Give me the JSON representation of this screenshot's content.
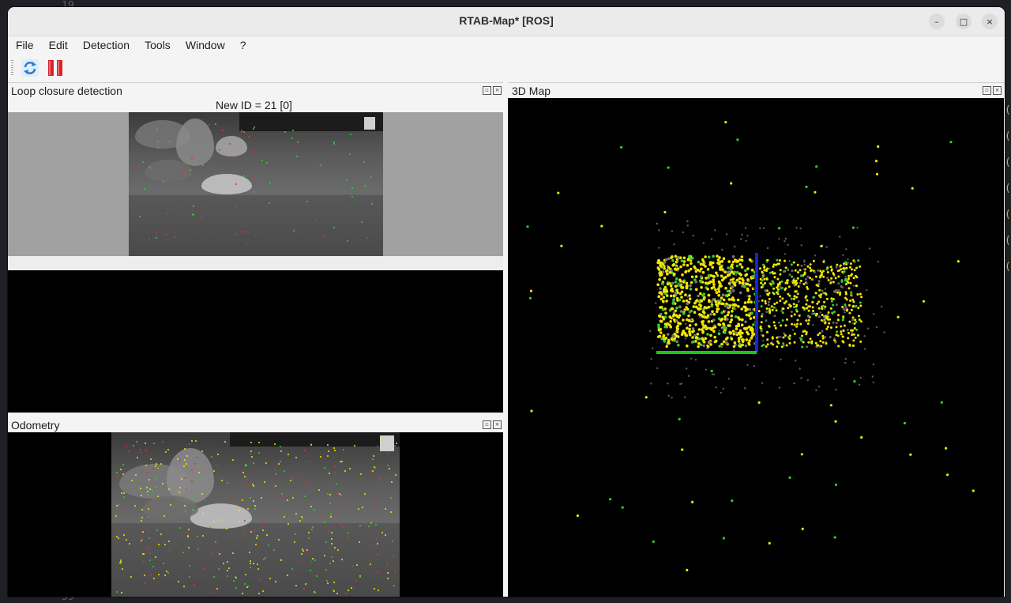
{
  "background": {
    "line_number_top": "19",
    "line_number_bottom": "59",
    "paren_glyph": "("
  },
  "window": {
    "title": "RTAB-Map* [ROS]",
    "controls": {
      "minimize": "–",
      "maximize": "□",
      "close": "×"
    }
  },
  "menu": [
    "File",
    "Edit",
    "Detection",
    "Tools",
    "Window",
    "?"
  ],
  "toolbar": {
    "buttons": [
      {
        "icon": "refresh-icon"
      },
      {
        "icon": "pause-icon"
      }
    ]
  },
  "docks": {
    "loop_closure": {
      "title": "Loop closure detection",
      "new_id_label": "New ID = 21 [0]"
    },
    "odometry": {
      "title": "Odometry"
    },
    "map3d": {
      "title": "3D Map"
    }
  },
  "colors": {
    "feature_yellow": "#f2e600",
    "feature_green": "#2fd12f",
    "feature_red": "#d2354a",
    "axis_blue": "#1a22d8",
    "axis_green": "#19c719"
  }
}
